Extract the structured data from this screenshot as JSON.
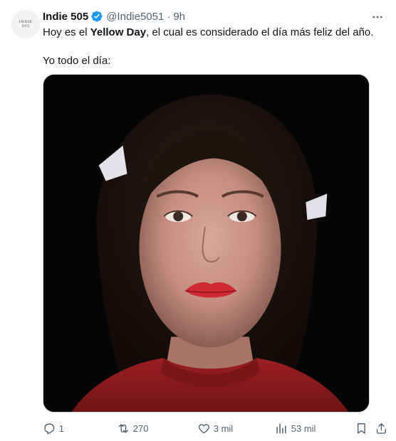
{
  "tweet": {
    "avatar_text_line1": "INDIE",
    "avatar_text_line2": "505",
    "author_name": "Indie 505",
    "handle": "@Indie5051",
    "separator": "·",
    "time": "9h",
    "text_before_bold": "Hoy es el ",
    "text_bold": "Yellow Day",
    "text_after_bold": ", el cual es considerado el día más feliz del año.",
    "text_line2": "Yo todo el día:",
    "verified_color": "#1d9bf0"
  },
  "actions": {
    "replies": "1",
    "reposts": "270",
    "likes": "3 mil",
    "views": "53 mil"
  },
  "icons": [
    "more-icon",
    "verified-badge-icon",
    "reply-icon",
    "repost-icon",
    "like-icon",
    "views-icon",
    "bookmark-icon",
    "share-icon"
  ]
}
